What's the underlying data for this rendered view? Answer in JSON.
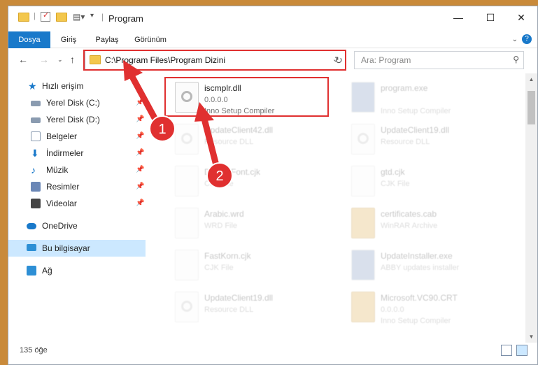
{
  "window": {
    "title": "Program",
    "controls": {
      "minimize": "—",
      "maximize": "☐",
      "close": "✕"
    }
  },
  "ribbon": {
    "tabs": [
      "Dosya",
      "Giriş",
      "Paylaş",
      "Görünüm"
    ],
    "active_tab": "Dosya",
    "help": "?",
    "accent": "#1979ca"
  },
  "nav": {
    "address": "C:\\Program Files\\Program Dizini",
    "search_placeholder": "Ara: Program"
  },
  "sidebar": {
    "items": [
      {
        "label": "Hızlı erişim",
        "icon": "star-icon",
        "pinned": false
      },
      {
        "label": "Yerel Disk (C:)",
        "icon": "drive-icon",
        "pinned": true
      },
      {
        "label": "Yerel Disk (D:)",
        "icon": "drive-icon",
        "pinned": true
      },
      {
        "label": "Belgeler",
        "icon": "documents-icon",
        "pinned": true
      },
      {
        "label": "İndirmeler",
        "icon": "download-icon",
        "pinned": true
      },
      {
        "label": "Müzik",
        "icon": "music-icon",
        "pinned": true
      },
      {
        "label": "Resimler",
        "icon": "pictures-icon",
        "pinned": true
      },
      {
        "label": "Videolar",
        "icon": "video-icon",
        "pinned": true
      },
      {
        "label": "OneDrive",
        "icon": "cloud-icon",
        "pinned": false
      },
      {
        "label": "Bu bilgisayar",
        "icon": "computer-icon",
        "pinned": false,
        "selected": true
      },
      {
        "label": "Ağ",
        "icon": "network-icon",
        "pinned": false
      }
    ]
  },
  "files": [
    {
      "name": "iscmplr.dll",
      "sub1": "0.0.0.0",
      "sub2": "Inno Setup Compiler",
      "icon": "dll-gear-icon",
      "highlight": true
    },
    {
      "name": "program.exe",
      "sub1": "",
      "sub2": "Inno Setup Compiler",
      "icon": "exe-icon"
    },
    {
      "name": "UpdateClient42.dll",
      "sub1": "Resource DLL",
      "sub2": "",
      "icon": "dll-gear-icon"
    },
    {
      "name": "UpdateClient19.dll",
      "sub1": "Resource DLL",
      "sub2": "",
      "icon": "dll-gear-icon"
    },
    {
      "name": "DefaultFont.cjk",
      "sub1": "CJK File",
      "sub2": "",
      "icon": "file-icon"
    },
    {
      "name": "gtd.cjk",
      "sub1": "CJK File",
      "sub2": "",
      "icon": "file-icon"
    },
    {
      "name": "Arabic.wrd",
      "sub1": "WRD File",
      "sub2": "",
      "icon": "file-icon"
    },
    {
      "name": "certificates.cab",
      "sub1": "WinRAR Archive",
      "sub2": "",
      "icon": "archive-icon"
    },
    {
      "name": "FastKorn.cjk",
      "sub1": "CJK File",
      "sub2": "",
      "icon": "file-icon"
    },
    {
      "name": "UpdateInstaller.exe",
      "sub1": "ABBY updates installer",
      "sub2": "",
      "icon": "installer-icon"
    },
    {
      "name": "UpdateClient19.dll",
      "sub1": "Resource DLL",
      "sub2": "",
      "icon": "dll-gear-icon"
    },
    {
      "name": "Microsoft.VC90.CRT",
      "sub1": "0.0.0.0",
      "sub2": "Inno Setup Compiler",
      "icon": "folder-icon"
    }
  ],
  "status": {
    "count": "135 öğe"
  },
  "annotations": {
    "badge1": "1",
    "badge2": "2",
    "color": "#e03030"
  }
}
